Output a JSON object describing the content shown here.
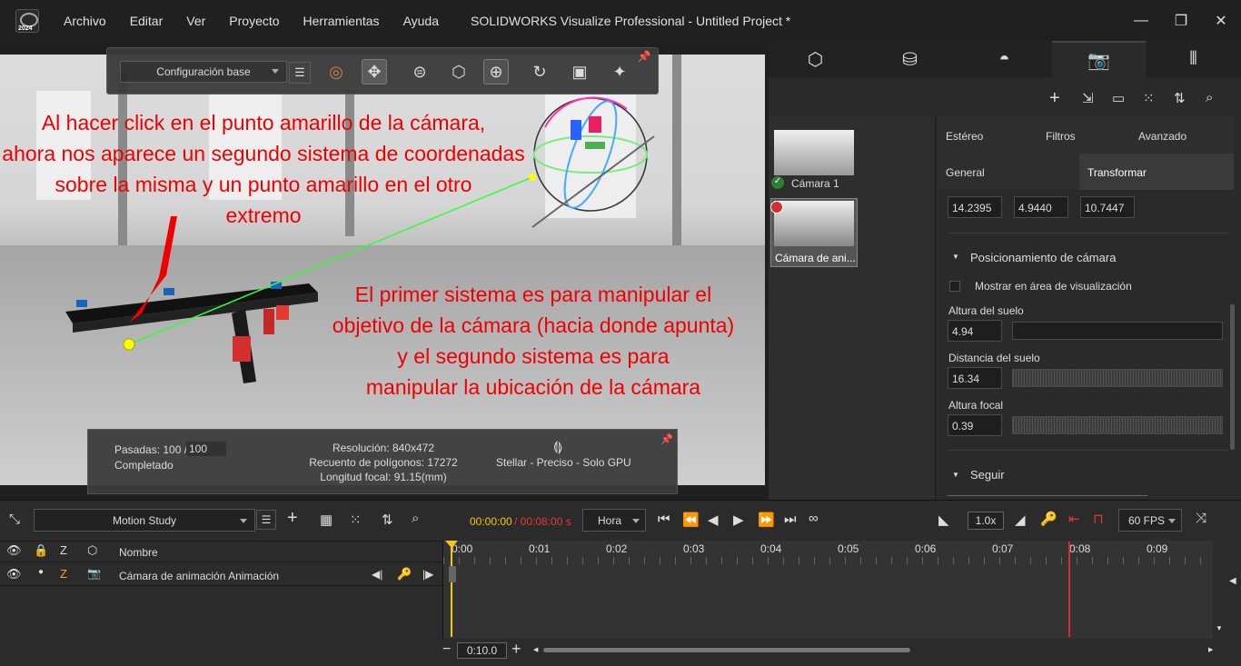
{
  "title_bar": {
    "logo_year": "2024",
    "menu": [
      "Archivo",
      "Editar",
      "Ver",
      "Proyecto",
      "Herramientas",
      "Ayuda"
    ],
    "app_title": "SOLIDWORKS Visualize Professional - Untitled Project *"
  },
  "toolbar": {
    "config_value": "Configuración base"
  },
  "annotations": {
    "top": "Al hacer click en el punto amarillo de la cámara,\nahora nos aparece un segundo sistema de coordenadas\nsobre la misma y un punto amarillo en el otro\nextremo",
    "bottom": "El primer sistema es para manipular el\nobjetivo de la cámara (hacia donde apunta)\ny el segundo sistema es para\nmanipular la ubicación de la cámara"
  },
  "render_info": {
    "passes_label": "Pasadas: 100 /",
    "passes_target": "100",
    "status": "Completado",
    "resolution": "Resolución: 840x472",
    "polygons": "Recuento de polígonos: 17272",
    "focal_length": "Longitud focal: 91.15(mm)",
    "renderer": "Stellar - Preciso - Solo GPU"
  },
  "cameras": [
    {
      "label": "Cámara 1",
      "status": "active"
    },
    {
      "label": "Cámara de ani...",
      "status": "recording"
    }
  ],
  "props": {
    "tabs_row1": [
      "Estéreo",
      "Filtros",
      "Avanzado"
    ],
    "tabs_row2": [
      "General",
      "Transformar"
    ],
    "xyz": [
      "14.2395",
      "4.9440",
      "10.7447"
    ],
    "section_positioning": "Posicionamiento de cámara",
    "show_in_viewport": "Mostrar en área de visualización",
    "floor_height_label": "Altura del suelo",
    "floor_height": "4.94",
    "floor_distance_label": "Distancia del suelo",
    "floor_distance": "16.34",
    "focal_height_label": "Altura focal",
    "focal_height": "0.39",
    "section_follow": "Seguir"
  },
  "timeline": {
    "study": "Motion Study",
    "time_current": "00:00:00",
    "time_total": "/ 00:08:00 s",
    "time_unit": "Hora",
    "speed": "1.0x",
    "fps": "60 FPS",
    "col_name": "Nombre",
    "track_name": "Cámara de animación Animación",
    "ticks": [
      "0:00",
      "0:01",
      "0:02",
      "0:03",
      "0:04",
      "0:05",
      "0:06",
      "0:07",
      "0:08",
      "0:09"
    ],
    "zoom": "0:10.0"
  }
}
